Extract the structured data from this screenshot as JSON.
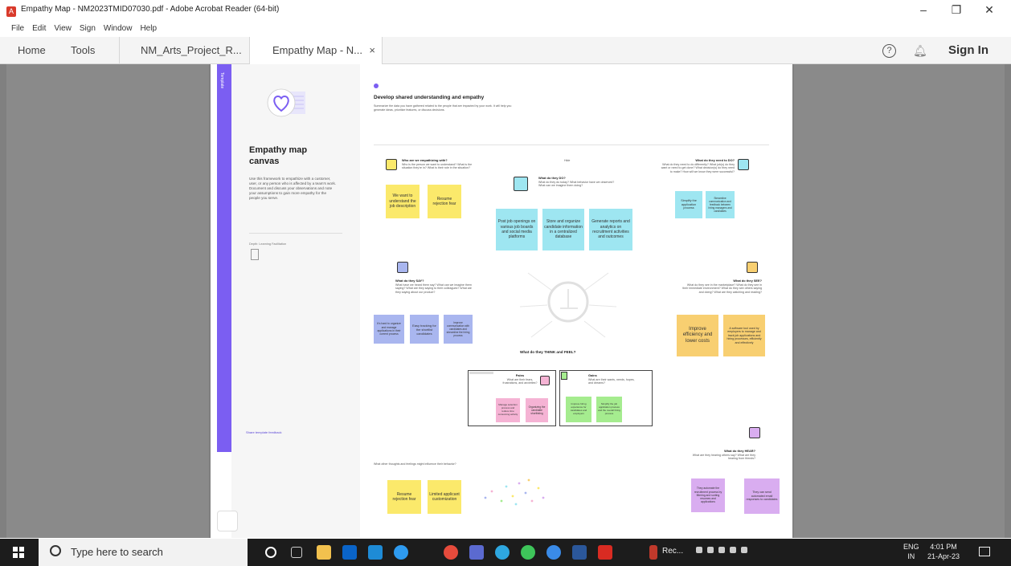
{
  "window": {
    "title": "Empathy Map - NM2023TMID07030.pdf - Adobe Acrobat Reader (64-bit)",
    "menu": [
      "File",
      "Edit",
      "View",
      "Sign",
      "Window",
      "Help"
    ],
    "controls": {
      "minimize": "–",
      "maximize": "❐",
      "close": "✕"
    }
  },
  "tabs": [
    {
      "label": "Home"
    },
    {
      "label": "Tools"
    },
    {
      "label": "NM_Arts_Project_R..."
    },
    {
      "label": "Empathy Map - N...",
      "close": "×"
    }
  ],
  "toolbar": {
    "help": "?",
    "sign_in": "Sign In"
  },
  "panel": {
    "strip_label": "Template",
    "title_line1": "Empathy map",
    "title_line2": "canvas",
    "description": "Use this framework to empathize with a customer, user, or any person who is affected by a team's work. Document and discuss your observations and note your assumptions to gain more empathy for the people you serve.",
    "small_label": "Depth: Learning Facilitation",
    "link": "Share template feedback"
  },
  "canvas": {
    "heading": "Develop shared understanding and empathy",
    "subheading": "Summarize the data you have gathered related to the people that are impacted by your work. It will help you generate ideas, prioritize features, or discuss decisions.",
    "center_label": "Hide",
    "who": {
      "title": "Who are we empathizing with?",
      "sub": "Who is the person we want to understand? What is the situation they're in? What is their role in the situation?",
      "notes": [
        "We want to understand the job description",
        "Resume rejection fear"
      ]
    },
    "do": {
      "title": "What do they DO?",
      "sub": "What do they do today? What behavior have we observed? What can we imagine them doing?",
      "notes": [
        "Post job openings on various job boards and social media platforms",
        "Store and organize candidate information in a centralized database",
        "Generate reports and analytics on recruitment activities and outcomes"
      ]
    },
    "need": {
      "title": "What do they need to DO?",
      "sub": "What do they need to do differently? What job(s) do they want or need to get done? What decision(s) do they need to make? How will we know they were successful?",
      "notes": [
        "Simplify the application process",
        "Streamline communication and feedback between hiring managers and candidates"
      ]
    },
    "see": {
      "title": "What do they SEE?",
      "sub": "What do they see in the marketplace? What do they see in their immediate environment? What do they see others saying and doing? What are they watching and reading?",
      "notes": [
        "Improve efficiency and lower costs",
        "A software tool used by employers to manage and track job applications and hiring processes, efficiently and effectively"
      ]
    },
    "say": {
      "title": "What do they SAY?",
      "sub": "What have we heard them say? What can we imagine them saying? What are they saying to their colleagues? What are they saying about our product?",
      "notes": [
        "It's hard to organize and manage applications in their current process",
        "Easy tracking for the shortlist candidates",
        "Improve communication with candidates and streamline the hiring process"
      ]
    },
    "think_feel": {
      "title": "What do they THINK and FEEL?",
      "pains": {
        "title": "Pains",
        "sub": "What are their fears, frustrations, and anxieties?",
        "notes": [
          "Manage selection process and reduce time consuming activity",
          "Organizing the candidate shortlisting"
        ]
      },
      "gains": {
        "title": "Gains",
        "sub": "What are their wants, needs, hopes, and dreams?",
        "notes": [
          "Improve hiring experience for candidates and employers",
          "Simplify the job application process and the overall hiring process"
        ]
      }
    },
    "hear": {
      "title": "What do they HEAR?",
      "sub": "What are they hearing others say? What are they hearing from friends?",
      "notes": [
        "They automate the recruitment process by filtering and sorting resumes and applications",
        "They can send automated email responses to candidates"
      ]
    },
    "bottom_label": "What other thoughts and feelings might influence their behavior?",
    "bottom_notes": [
      "Resume rejection fear",
      "Limited applicant customization"
    ]
  },
  "taskbar": {
    "search_placeholder": "Type here to search",
    "tray_app": "Rec...",
    "lang1": "ENG",
    "lang2": "IN",
    "time": "4:01 PM",
    "date": "21-Apr-23"
  },
  "colors": {
    "accent": "#7b5ef2",
    "note_yellow": "#fbe96b",
    "note_blue": "#9ee6f1",
    "note_periwinkle": "#a9b6ef",
    "note_orange": "#f8cf71",
    "note_pink": "#f5b3d4",
    "note_green": "#a5ec8f",
    "note_violet": "#d9adf0"
  }
}
